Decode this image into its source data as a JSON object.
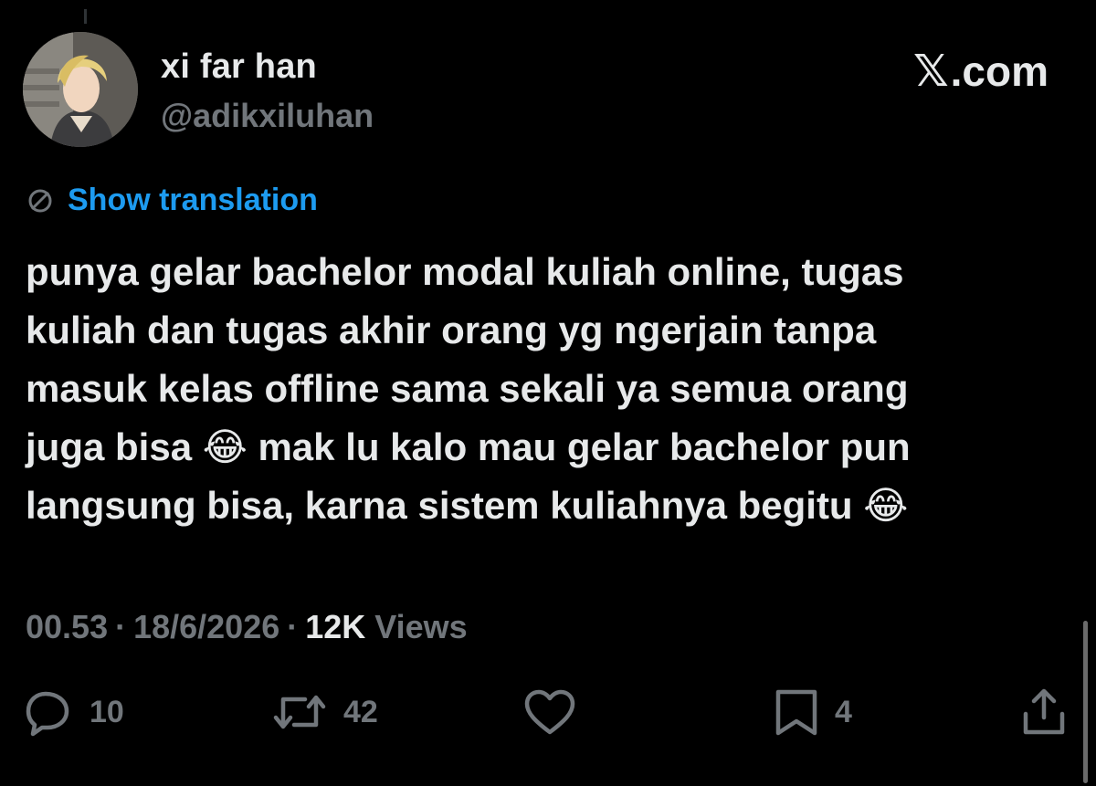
{
  "author": {
    "display_name": "xi far han",
    "handle": "@adikxiluhan"
  },
  "brand": {
    "x_glyph": "𝕏",
    "suffix": ".com"
  },
  "translation": {
    "link_label": "Show translation",
    "icon": "globe-icon"
  },
  "tweet": {
    "text": "punya gelar bachelor modal kuliah online, tugas\nkuliah dan tugas akhir orang yg ngerjain tanpa\nmasuk kelas offline sama sekali ya semua orang\njuga bisa 😂 mak lu kalo mau gelar bachelor pun\nlangsung bisa, karna sistem kuliahnya begitu 😂"
  },
  "meta": {
    "time": "00.53",
    "separator": "·",
    "date": "18/6/2026",
    "views_count": "12K",
    "views_label": "Views"
  },
  "actions": {
    "reply_count": "10",
    "retweet_count": "42",
    "bookmark_count": "4"
  },
  "colors": {
    "background": "#000000",
    "primary_text": "#e7e9ea",
    "secondary_text": "#71767b",
    "link": "#1d9bf0"
  }
}
